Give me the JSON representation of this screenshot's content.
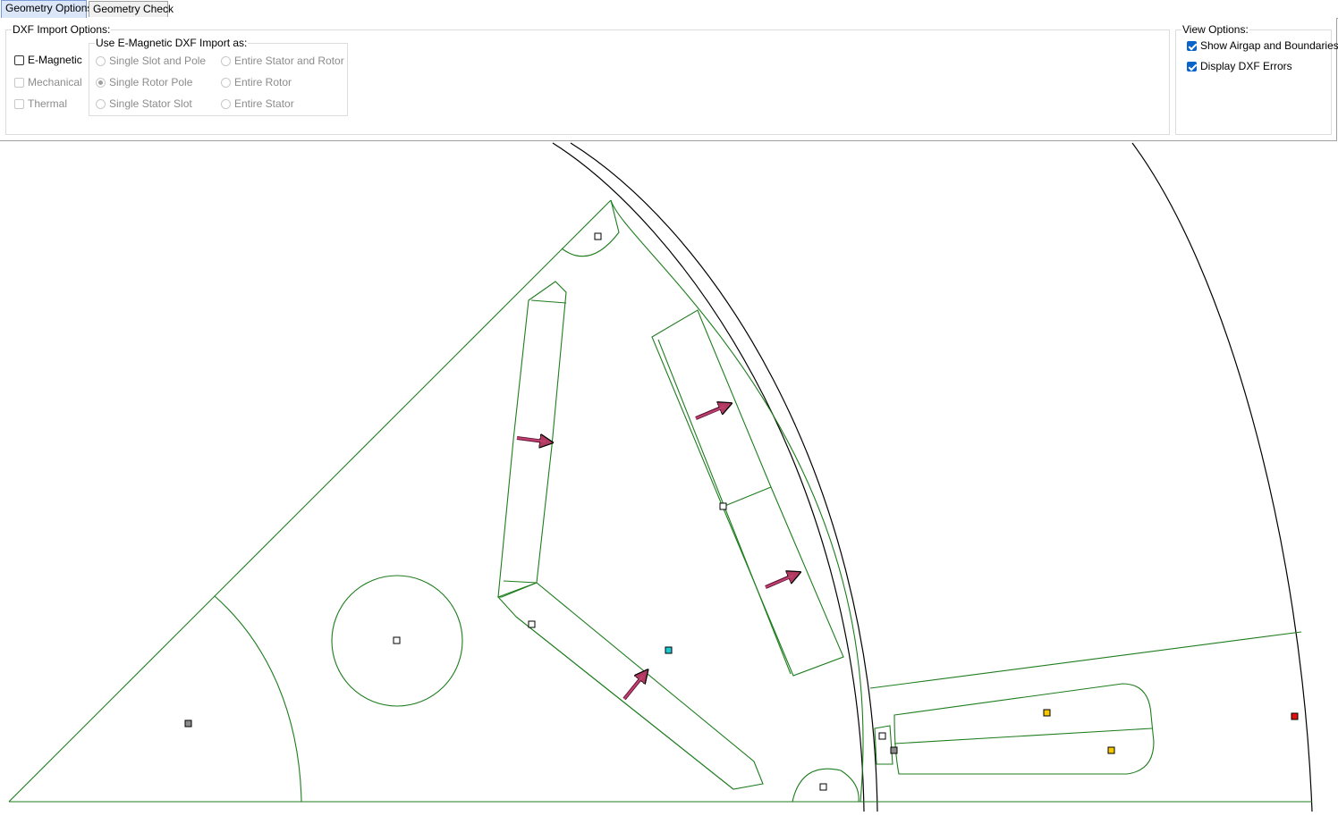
{
  "tabs": [
    {
      "label": "Geometry Options",
      "active": true
    },
    {
      "label": "Geometry Check",
      "active": false
    }
  ],
  "dxf_import": {
    "title": "DXF Import Options:",
    "checkboxes": [
      {
        "label": "E-Magnetic",
        "checked": false,
        "enabled": true
      },
      {
        "label": "Mechanical",
        "checked": false,
        "enabled": false
      },
      {
        "label": "Thermal",
        "checked": false,
        "enabled": false
      }
    ],
    "use_as": {
      "title": "Use E-Magnetic DXF Import as:",
      "radios": [
        {
          "label": "Single Slot and Pole",
          "selected": false
        },
        {
          "label": "Single Rotor Pole",
          "selected": true
        },
        {
          "label": "Single Stator Slot",
          "selected": false
        },
        {
          "label": "Entire Stator and Rotor",
          "selected": false
        },
        {
          "label": "Entire Rotor",
          "selected": false
        },
        {
          "label": "Entire Stator",
          "selected": false
        }
      ]
    }
  },
  "view_options": {
    "title": "View Options:",
    "items": [
      {
        "label": "Show Airgap and Boundaries",
        "checked": true
      },
      {
        "label": "Display DXF Errors",
        "checked": true
      }
    ]
  },
  "colors": {
    "geometry_line": "#1e7d1e",
    "boundary_line": "#000000",
    "magnet_arrow": "#b03a60",
    "marker_gray": "#8c8c8c",
    "marker_cyan": "#1ec8d2",
    "marker_yellow": "#f5c800",
    "marker_red": "#e01010",
    "tab_active_bg": "#dbe6f8"
  }
}
